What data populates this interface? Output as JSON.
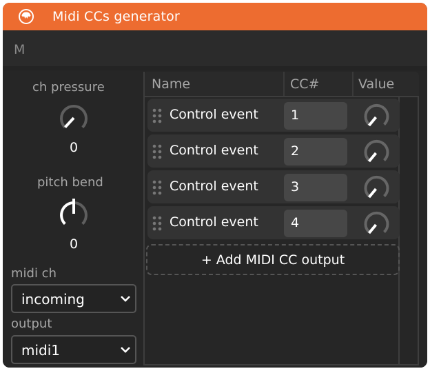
{
  "window": {
    "title": "Midi CCs generator",
    "title_icon": "device-logo-icon",
    "accent_color": "#ED6C30"
  },
  "toolbar": {
    "m_label": "M"
  },
  "left_panel": {
    "ch_pressure": {
      "label": "ch pressure",
      "value": "0",
      "knob_fraction": 0
    },
    "pitch_bend": {
      "label": "pitch bend",
      "value": "0",
      "knob_fraction": 0.5
    },
    "midi_ch": {
      "label": "midi ch",
      "selected": "incoming"
    },
    "output": {
      "label": "output",
      "selected": "midi1"
    }
  },
  "table": {
    "columns": [
      "Name",
      "CC#",
      "Value"
    ],
    "rows": [
      {
        "name": "Control event",
        "cc": "1",
        "value_fraction": 0
      },
      {
        "name": "Control event",
        "cc": "2",
        "value_fraction": 0
      },
      {
        "name": "Control event",
        "cc": "3",
        "value_fraction": 0
      },
      {
        "name": "Control event",
        "cc": "4",
        "value_fraction": 0
      }
    ],
    "add_button_label": "+ Add MIDI CC output"
  }
}
